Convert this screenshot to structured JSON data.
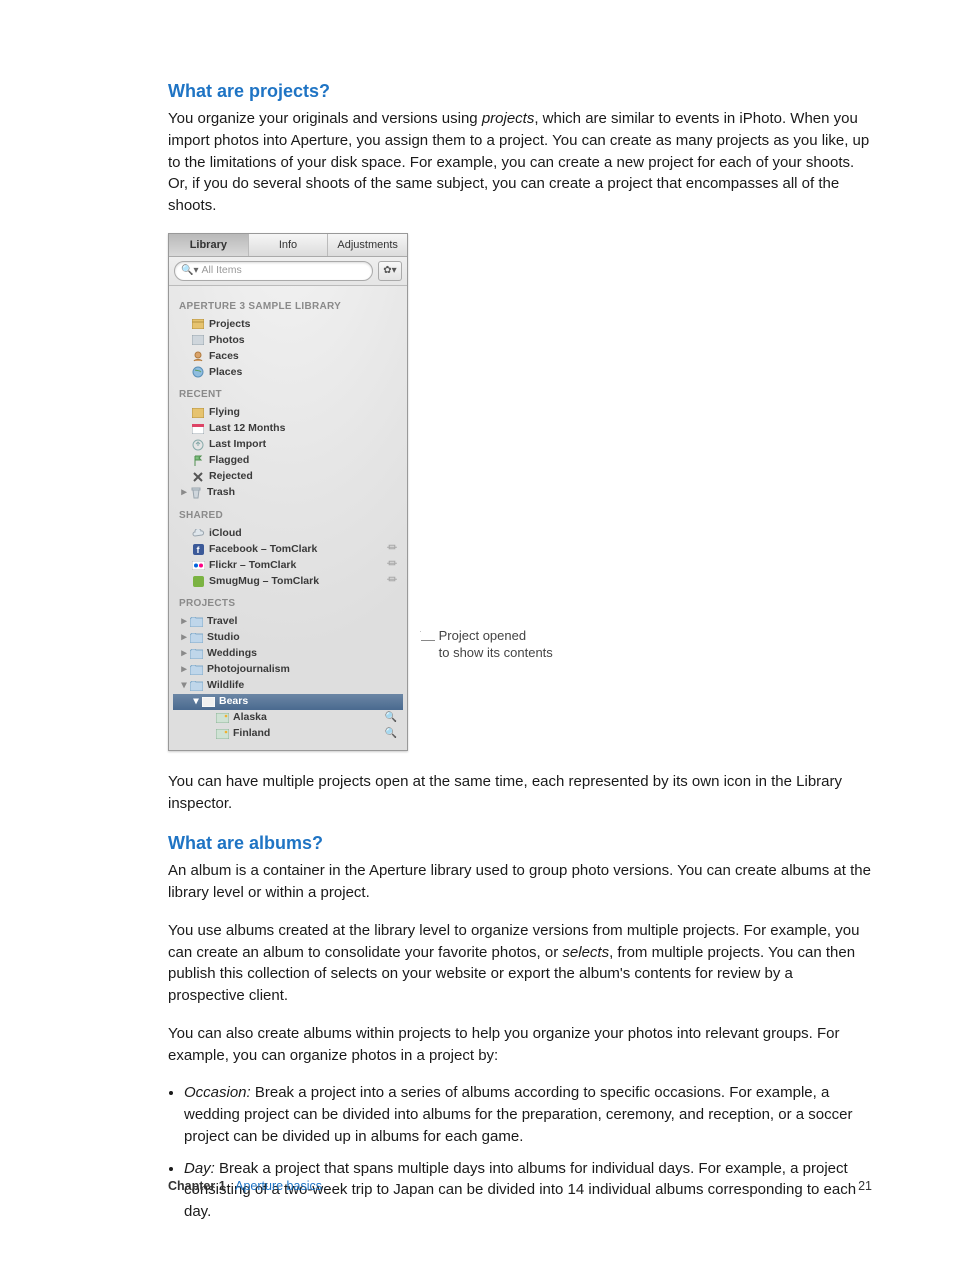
{
  "ui": {
    "tabs": [
      "Library",
      "Info",
      "Adjustments"
    ],
    "search_placeholder": "All Items",
    "sections": {
      "lib_hdr": "APERTURE 3 SAMPLE LIBRARY",
      "lib": [
        "Projects",
        "Photos",
        "Faces",
        "Places"
      ],
      "recent_hdr": "RECENT",
      "recent": [
        "Flying",
        "Last 12 Months",
        "Last Import",
        "Flagged",
        "Rejected",
        "Trash"
      ],
      "shared_hdr": "SHARED",
      "shared": [
        "iCloud",
        "Facebook – TomClark",
        "Flickr – TomClark",
        "SmugMug – TomClark"
      ],
      "projects_hdr": "PROJECTS",
      "projects": [
        "Travel",
        "Studio",
        "Weddings",
        "Photojournalism",
        "Wildlife"
      ],
      "wildlife_child": "Bears",
      "bears_children": [
        "Alaska",
        "Finland"
      ]
    }
  },
  "callout": {
    "l1": "Project opened",
    "l2": "to show its contents"
  },
  "s1": {
    "h": "What are projects?",
    "p1a": "You organize your originals and versions using ",
    "p1i": "projects",
    "p1b": ", which are similar to events in iPhoto. When you import photos into Aperture, you assign them to a project. You can create as many projects as you like, up to the limitations of your disk space. For example, you can create a new project for each of your shoots. Or, if you do several shoots of the same subject, you can create a project that encompasses all of the shoots.",
    "p2": "You can have multiple projects open at the same time, each represented by its own icon in the Library inspector."
  },
  "s2": {
    "h": "What are albums?",
    "p1": "An album is a container in the Aperture library used to group photo versions. You can create albums at the library level or within a project.",
    "p2a": "You use albums created at the library level to organize versions from multiple projects. For example, you can create an album to consolidate your favorite photos, or ",
    "p2i": "selects",
    "p2b": ", from multiple projects. You can then publish this collection of selects on your website or export the album's contents for review by a prospective client.",
    "p3": "You can also create albums within projects to help you organize your photos into relevant groups. For example, you can organize photos in a project by:",
    "b1i": "Occasion:",
    "b1": " Break a project into a series of albums according to specific occasions. For example, a wedding project can be divided into albums for the preparation, ceremony, and reception, or a soccer project can be divided up in albums for each game.",
    "b2i": "Day:",
    "b2": " Break a project that spans multiple days into albums for individual days. For example, a project consisting of a two-week trip to Japan can be divided into 14 individual albums corresponding to each day."
  },
  "footer": {
    "ch": "Chapter 1",
    "title": "Aperture basics",
    "page": "21"
  }
}
